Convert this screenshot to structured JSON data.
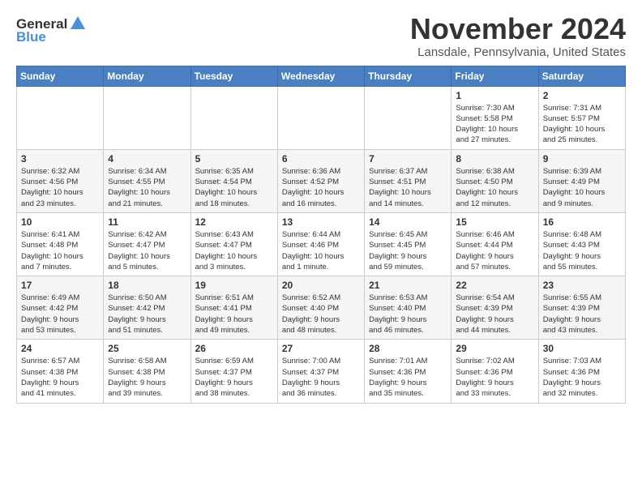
{
  "logo": {
    "text_general": "General",
    "text_blue": "Blue"
  },
  "header": {
    "month_title": "November 2024",
    "location": "Lansdale, Pennsylvania, United States"
  },
  "weekdays": [
    "Sunday",
    "Monday",
    "Tuesday",
    "Wednesday",
    "Thursday",
    "Friday",
    "Saturday"
  ],
  "weeks": [
    [
      {
        "day": "",
        "info": ""
      },
      {
        "day": "",
        "info": ""
      },
      {
        "day": "",
        "info": ""
      },
      {
        "day": "",
        "info": ""
      },
      {
        "day": "",
        "info": ""
      },
      {
        "day": "1",
        "info": "Sunrise: 7:30 AM\nSunset: 5:58 PM\nDaylight: 10 hours\nand 27 minutes."
      },
      {
        "day": "2",
        "info": "Sunrise: 7:31 AM\nSunset: 5:57 PM\nDaylight: 10 hours\nand 25 minutes."
      }
    ],
    [
      {
        "day": "3",
        "info": "Sunrise: 6:32 AM\nSunset: 4:56 PM\nDaylight: 10 hours\nand 23 minutes."
      },
      {
        "day": "4",
        "info": "Sunrise: 6:34 AM\nSunset: 4:55 PM\nDaylight: 10 hours\nand 21 minutes."
      },
      {
        "day": "5",
        "info": "Sunrise: 6:35 AM\nSunset: 4:54 PM\nDaylight: 10 hours\nand 18 minutes."
      },
      {
        "day": "6",
        "info": "Sunrise: 6:36 AM\nSunset: 4:52 PM\nDaylight: 10 hours\nand 16 minutes."
      },
      {
        "day": "7",
        "info": "Sunrise: 6:37 AM\nSunset: 4:51 PM\nDaylight: 10 hours\nand 14 minutes."
      },
      {
        "day": "8",
        "info": "Sunrise: 6:38 AM\nSunset: 4:50 PM\nDaylight: 10 hours\nand 12 minutes."
      },
      {
        "day": "9",
        "info": "Sunrise: 6:39 AM\nSunset: 4:49 PM\nDaylight: 10 hours\nand 9 minutes."
      }
    ],
    [
      {
        "day": "10",
        "info": "Sunrise: 6:41 AM\nSunset: 4:48 PM\nDaylight: 10 hours\nand 7 minutes."
      },
      {
        "day": "11",
        "info": "Sunrise: 6:42 AM\nSunset: 4:47 PM\nDaylight: 10 hours\nand 5 minutes."
      },
      {
        "day": "12",
        "info": "Sunrise: 6:43 AM\nSunset: 4:47 PM\nDaylight: 10 hours\nand 3 minutes."
      },
      {
        "day": "13",
        "info": "Sunrise: 6:44 AM\nSunset: 4:46 PM\nDaylight: 10 hours\nand 1 minute."
      },
      {
        "day": "14",
        "info": "Sunrise: 6:45 AM\nSunset: 4:45 PM\nDaylight: 9 hours\nand 59 minutes."
      },
      {
        "day": "15",
        "info": "Sunrise: 6:46 AM\nSunset: 4:44 PM\nDaylight: 9 hours\nand 57 minutes."
      },
      {
        "day": "16",
        "info": "Sunrise: 6:48 AM\nSunset: 4:43 PM\nDaylight: 9 hours\nand 55 minutes."
      }
    ],
    [
      {
        "day": "17",
        "info": "Sunrise: 6:49 AM\nSunset: 4:42 PM\nDaylight: 9 hours\nand 53 minutes."
      },
      {
        "day": "18",
        "info": "Sunrise: 6:50 AM\nSunset: 4:42 PM\nDaylight: 9 hours\nand 51 minutes."
      },
      {
        "day": "19",
        "info": "Sunrise: 6:51 AM\nSunset: 4:41 PM\nDaylight: 9 hours\nand 49 minutes."
      },
      {
        "day": "20",
        "info": "Sunrise: 6:52 AM\nSunset: 4:40 PM\nDaylight: 9 hours\nand 48 minutes."
      },
      {
        "day": "21",
        "info": "Sunrise: 6:53 AM\nSunset: 4:40 PM\nDaylight: 9 hours\nand 46 minutes."
      },
      {
        "day": "22",
        "info": "Sunrise: 6:54 AM\nSunset: 4:39 PM\nDaylight: 9 hours\nand 44 minutes."
      },
      {
        "day": "23",
        "info": "Sunrise: 6:55 AM\nSunset: 4:39 PM\nDaylight: 9 hours\nand 43 minutes."
      }
    ],
    [
      {
        "day": "24",
        "info": "Sunrise: 6:57 AM\nSunset: 4:38 PM\nDaylight: 9 hours\nand 41 minutes."
      },
      {
        "day": "25",
        "info": "Sunrise: 6:58 AM\nSunset: 4:38 PM\nDaylight: 9 hours\nand 39 minutes."
      },
      {
        "day": "26",
        "info": "Sunrise: 6:59 AM\nSunset: 4:37 PM\nDaylight: 9 hours\nand 38 minutes."
      },
      {
        "day": "27",
        "info": "Sunrise: 7:00 AM\nSunset: 4:37 PM\nDaylight: 9 hours\nand 36 minutes."
      },
      {
        "day": "28",
        "info": "Sunrise: 7:01 AM\nSunset: 4:36 PM\nDaylight: 9 hours\nand 35 minutes."
      },
      {
        "day": "29",
        "info": "Sunrise: 7:02 AM\nSunset: 4:36 PM\nDaylight: 9 hours\nand 33 minutes."
      },
      {
        "day": "30",
        "info": "Sunrise: 7:03 AM\nSunset: 4:36 PM\nDaylight: 9 hours\nand 32 minutes."
      }
    ]
  ]
}
